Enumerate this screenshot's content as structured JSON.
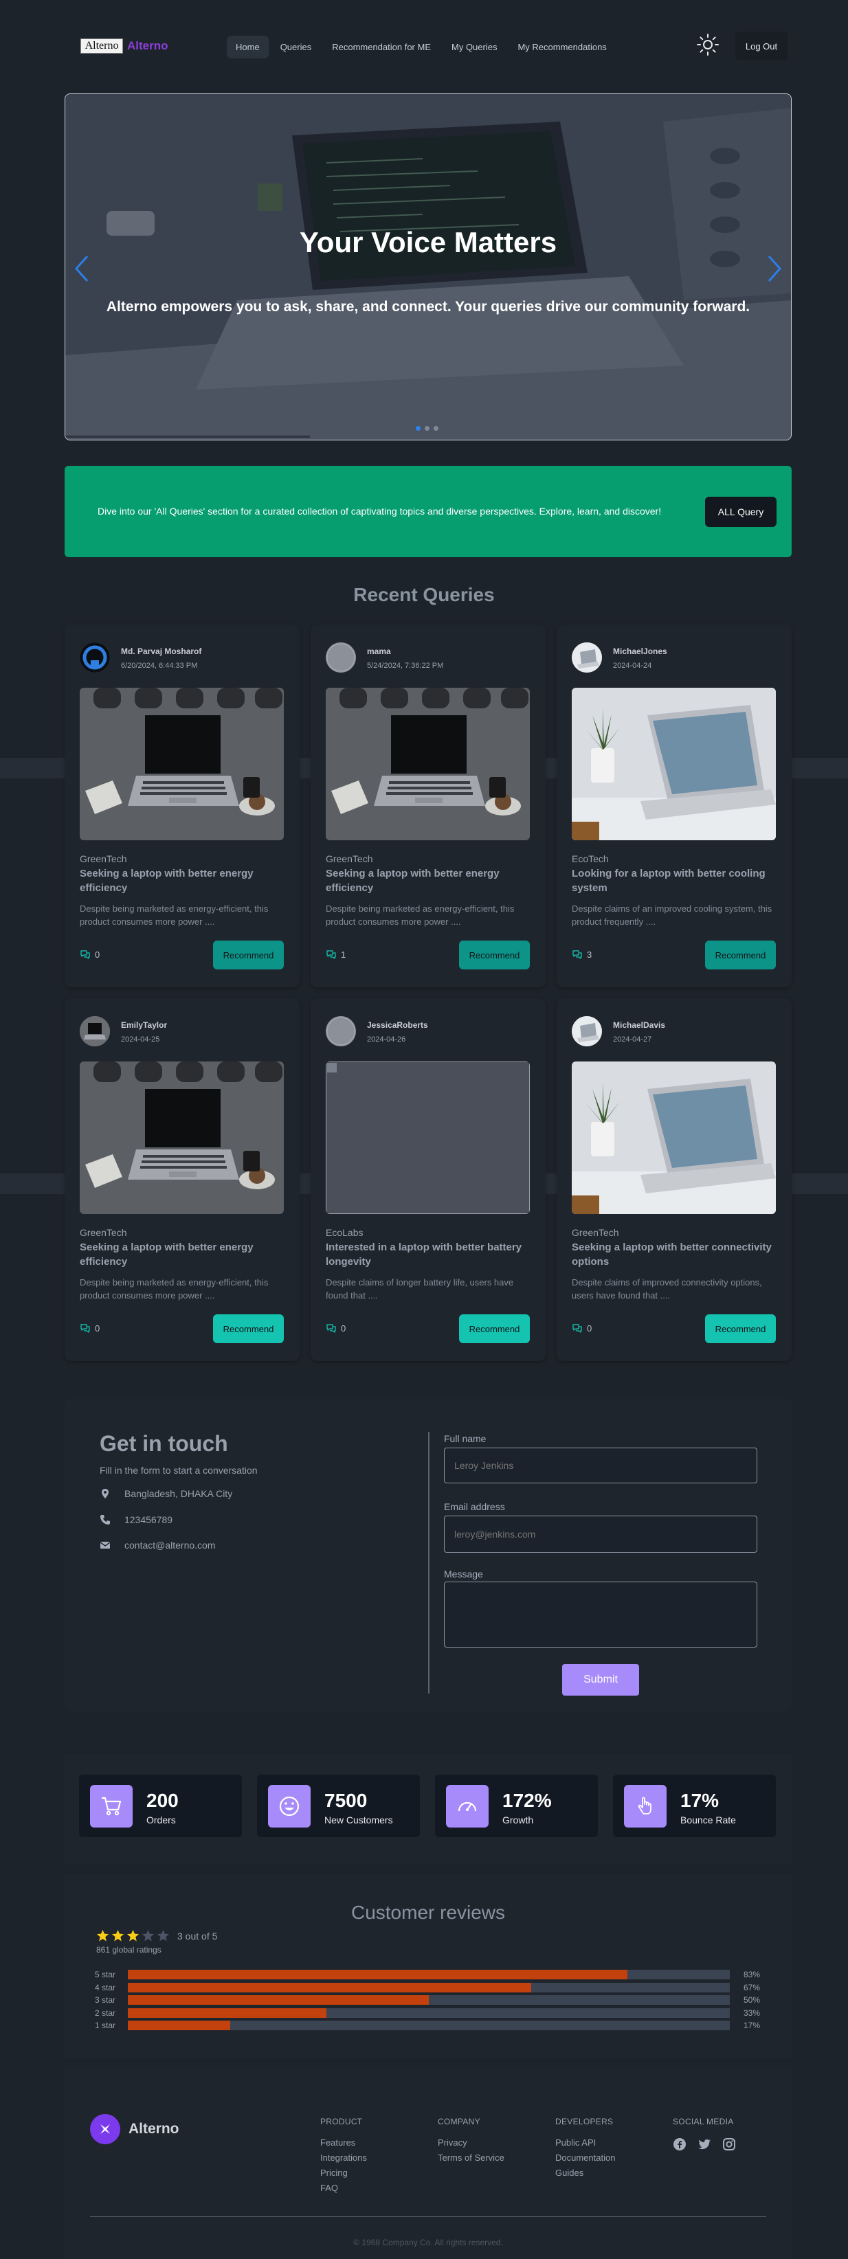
{
  "navbar": {
    "logo_image_alt": "Alterno",
    "logo_text": "Alterno",
    "links": [
      "Home",
      "Queries",
      "Recommendation for ME",
      "My Queries",
      "My Recommendations"
    ],
    "active_link": "Home",
    "theme_icon": "sun-icon",
    "logout_label": "Log Out"
  },
  "hero": {
    "title": "Your Voice Matters",
    "subtitle": "Alterno empowers you to ask, share, and connect. Your queries drive our community forward.",
    "slide_count": 3,
    "active_slide": 1
  },
  "cta": {
    "text": "Dive into our 'All Queries' section for a curated collection of captivating topics and diverse perspectives. Explore, learn, and discover!",
    "button_label": "ALL Query"
  },
  "recent_queries": {
    "title": "Recent Queries",
    "cards": [
      {
        "user": "Md. Parvaj Mosharof",
        "date": "6/20/2024, 6:44:33 PM",
        "brand": "GreenTech",
        "title": "Seeking a laptop with better energy efficiency",
        "description": "Despite being marketed as energy-efficient, this product consumes more power ....",
        "recommendations": "0",
        "button": "Recommend",
        "image": "laptop-dark",
        "button_color": "#0d9488"
      },
      {
        "user": "mama",
        "date": "5/24/2024, 7:36:22 PM",
        "brand": "GreenTech",
        "title": "Seeking a laptop with better energy efficiency",
        "description": "Despite being marketed as energy-efficient, this product consumes more power ....",
        "recommendations": "1",
        "button": "Recommend",
        "image": "laptop-dark",
        "button_color": "#0d9488"
      },
      {
        "user": "MichaelJones",
        "date": "2024-04-24",
        "brand": "EcoTech",
        "title": "Looking for a laptop with better cooling system",
        "description": "Despite claims of an improved cooling system, this product frequently ....",
        "recommendations": "3",
        "button": "Recommend",
        "image": "laptop-plant",
        "button_color": "#0d9488"
      },
      {
        "user": "EmilyTaylor",
        "date": "2024-04-25",
        "brand": "GreenTech",
        "title": "Seeking a laptop with better energy efficiency",
        "description": "Despite being marketed as energy-efficient, this product consumes more power ....",
        "recommendations": "0",
        "button": "Recommend",
        "image": "laptop-dark",
        "button_color": "#14c3b0"
      },
      {
        "user": "JessicaRoberts",
        "date": "2024-04-26",
        "brand": "EcoLabs",
        "title": "Interested in a laptop with better battery longevity",
        "description": "Despite claims of longer battery life, users have found that ....",
        "recommendations": "0",
        "button": "Recommend",
        "image": "broken",
        "button_color": "#14c3b0"
      },
      {
        "user": "MichaelDavis",
        "date": "2024-04-27",
        "brand": "GreenTech",
        "title": "Seeking a laptop with better connectivity options",
        "description": "Despite claims of improved connectivity options, users have found that ....",
        "recommendations": "0",
        "button": "Recommend",
        "image": "laptop-plant",
        "button_color": "#14c3b0"
      }
    ]
  },
  "contact": {
    "title": "Get in touch",
    "subtitle": "Fill in the form to start a conversation",
    "address": "Bangladesh, DHAKA City",
    "phone": "123456789",
    "email": "contact@alterno.com",
    "form": {
      "name_label": "Full name",
      "name_placeholder": "Leroy Jenkins",
      "email_label": "Email address",
      "email_placeholder": "leroy@jenkins.com",
      "message_label": "Message",
      "message_placeholder": "",
      "submit_label": "Submit"
    }
  },
  "stats": [
    {
      "value": "200",
      "label": "Orders",
      "icon": "cart-icon"
    },
    {
      "value": "7500",
      "label": "New Customers",
      "icon": "smiley-icon"
    },
    {
      "value": "172%",
      "label": "Growth",
      "icon": "gauge-icon"
    },
    {
      "value": "17%",
      "label": "Bounce Rate",
      "icon": "pointer-icon"
    }
  ],
  "reviews": {
    "title": "Customer reviews",
    "rating_stars": 3,
    "rating_text": "3 out of 5",
    "global_ratings": "861 global ratings",
    "star_color": "#facc15",
    "bar_color": "#c2410c",
    "bars": [
      {
        "label": "5 star",
        "percent_text": "83%",
        "percent": 83
      },
      {
        "label": "4 star",
        "percent_text": "67%",
        "percent": 67
      },
      {
        "label": "3 star",
        "percent_text": "50%",
        "percent": 50
      },
      {
        "label": "2 star",
        "percent_text": "33%",
        "percent": 33
      },
      {
        "label": "1 star",
        "percent_text": "17%",
        "percent": 17
      }
    ]
  },
  "footer": {
    "logo_text": "Alterno",
    "columns": [
      {
        "heading": "PRODUCT",
        "items": [
          "Features",
          "Integrations",
          "Pricing",
          "FAQ"
        ]
      },
      {
        "heading": "COMPANY",
        "items": [
          "Privacy",
          "Terms of Service"
        ]
      },
      {
        "heading": "DEVELOPERS",
        "items": [
          "Public API",
          "Documentation",
          "Guides"
        ]
      }
    ],
    "social_heading": "SOCIAL MEDIA",
    "social_icons": [
      "facebook-icon",
      "twitter-icon",
      "instagram-icon"
    ],
    "copyright": "© 1968 Company Co. All rights reserved."
  }
}
